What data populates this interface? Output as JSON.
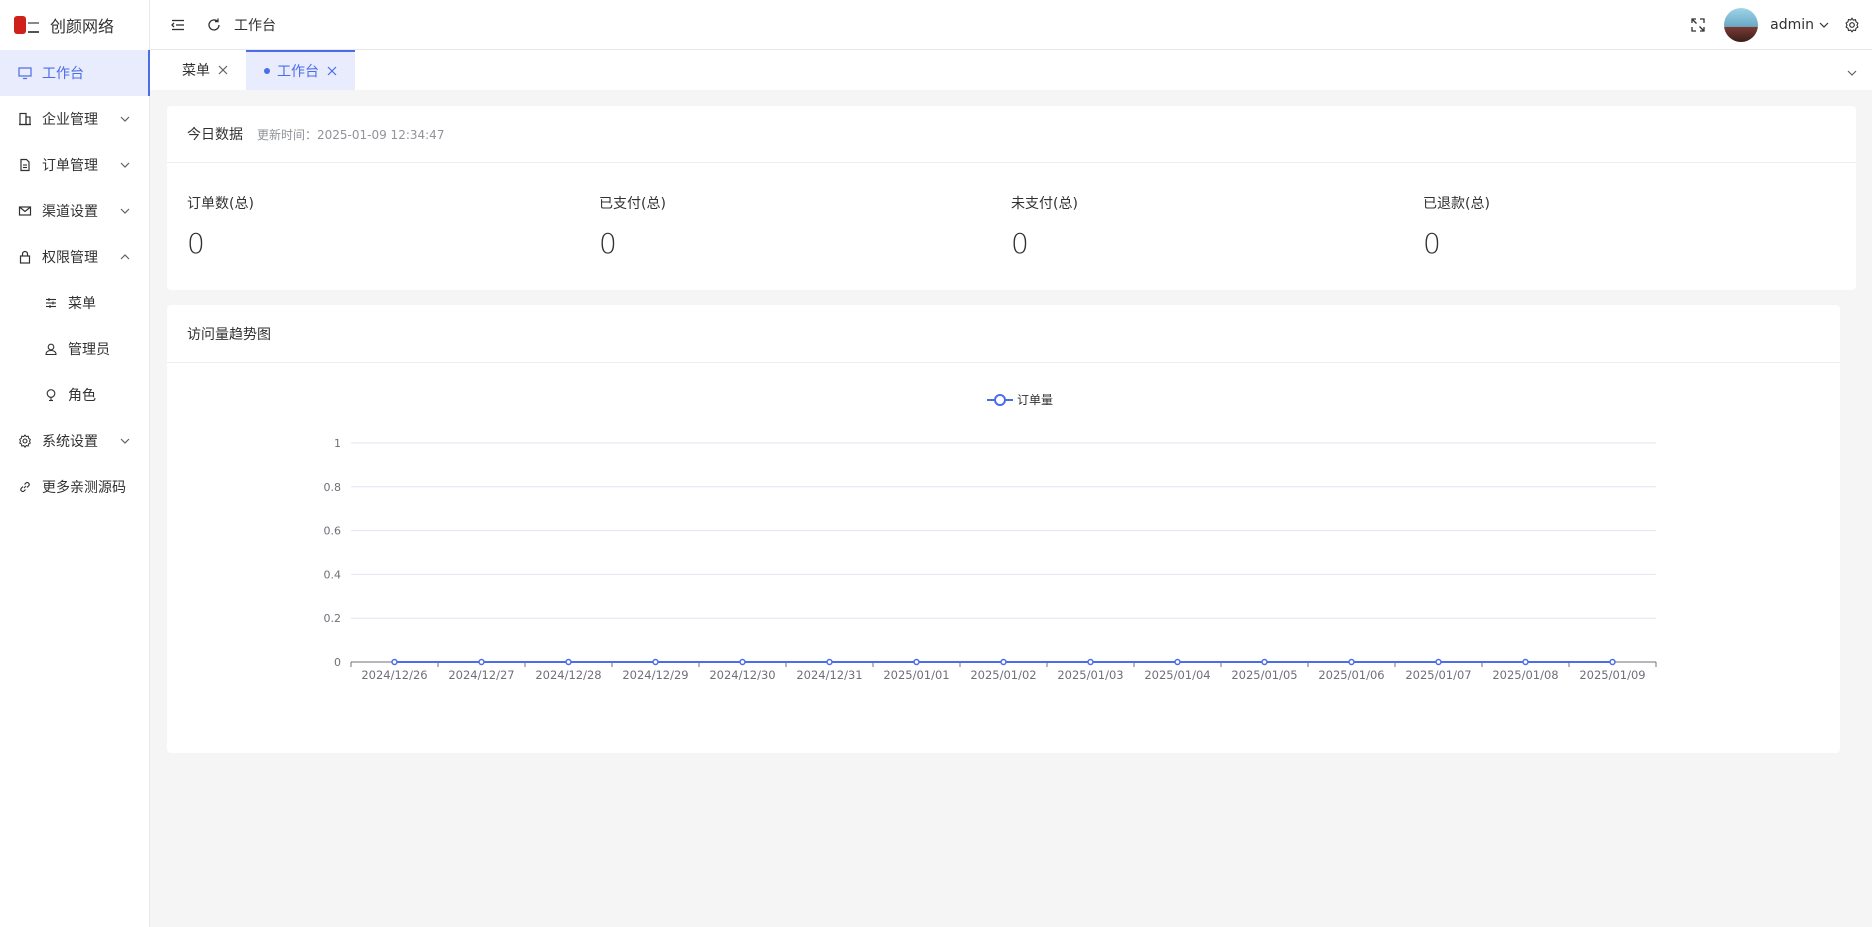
{
  "app": {
    "title": "创颜网络"
  },
  "sidebar": {
    "items": [
      {
        "label": "工作台",
        "icon": "monitor-icon",
        "active": true
      },
      {
        "label": "企业管理",
        "icon": "building-icon",
        "expandable": true
      },
      {
        "label": "订单管理",
        "icon": "document-icon",
        "expandable": true
      },
      {
        "label": "渠道设置",
        "icon": "mail-icon",
        "expandable": true
      },
      {
        "label": "权限管理",
        "icon": "lock-icon",
        "expandable": true,
        "expanded": true
      },
      {
        "label": "菜单",
        "icon": "sliders-icon",
        "sub": true
      },
      {
        "label": "管理员",
        "icon": "user-icon",
        "sub": true
      },
      {
        "label": "角色",
        "icon": "bulb-icon",
        "sub": true
      },
      {
        "label": "系统设置",
        "icon": "gear-icon",
        "expandable": true
      },
      {
        "label": "更多亲测源码",
        "icon": "link-icon"
      }
    ]
  },
  "topbar": {
    "breadcrumb": "工作台",
    "user": "admin"
  },
  "tabs": [
    {
      "label": "菜单",
      "active": false
    },
    {
      "label": "工作台",
      "active": true
    }
  ],
  "today": {
    "title": "今日数据",
    "update_time": "更新时间：2025-01-09 12:34:47",
    "stats": [
      {
        "label": "订单数(总)",
        "value": "0"
      },
      {
        "label": "已支付(总)",
        "value": "0"
      },
      {
        "label": "未支付(总)",
        "value": "0"
      },
      {
        "label": "已退款(总)",
        "value": "0"
      }
    ]
  },
  "trend": {
    "title": "访问量趋势图",
    "legend": "订单量"
  },
  "colors": {
    "accent": "#4c6ce8",
    "series": "#4c6ce8"
  },
  "chart_data": {
    "type": "line",
    "title": "",
    "categories": [
      "2024/12/26",
      "2024/12/27",
      "2024/12/28",
      "2024/12/29",
      "2024/12/30",
      "2024/12/31",
      "2025/01/01",
      "2025/01/02",
      "2025/01/03",
      "2025/01/04",
      "2025/01/05",
      "2025/01/06",
      "2025/01/07",
      "2025/01/08",
      "2025/01/09"
    ],
    "series": [
      {
        "name": "订单量",
        "values": [
          0,
          0,
          0,
          0,
          0,
          0,
          0,
          0,
          0,
          0,
          0,
          0,
          0,
          0,
          0
        ]
      }
    ],
    "y_ticks": [
      "0",
      "0.2",
      "0.4",
      "0.6",
      "0.8",
      "1"
    ],
    "ylim": [
      0,
      1
    ],
    "grid": true,
    "legend_position": "top-center"
  }
}
